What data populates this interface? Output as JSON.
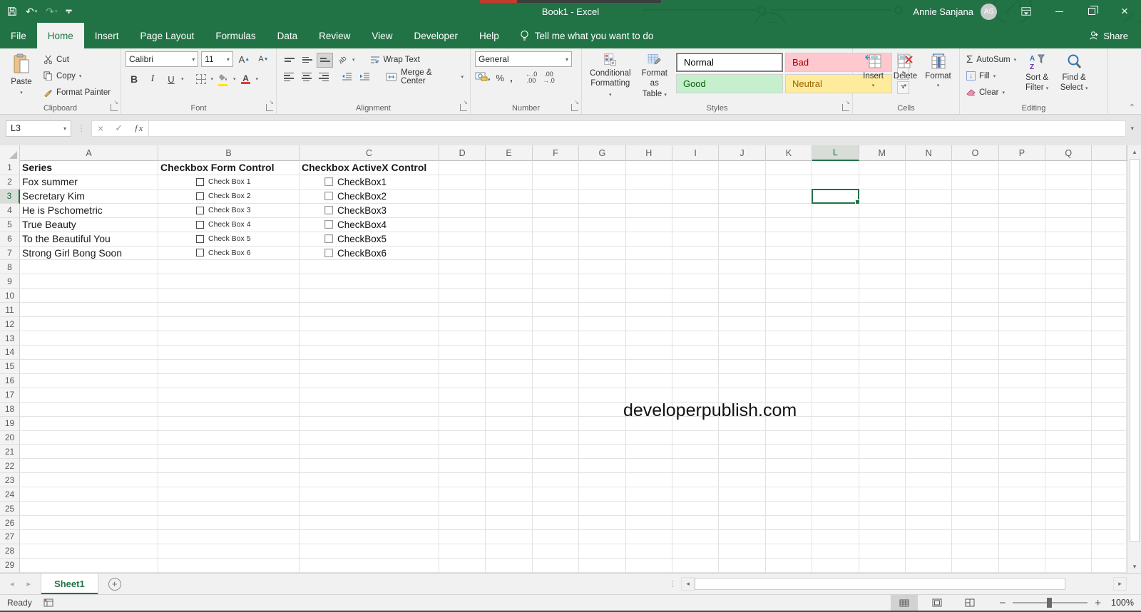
{
  "window": {
    "title": "Book1  -  Excel",
    "user_name": "Annie Sanjana",
    "avatar_initials": "AS",
    "share_label": "Share"
  },
  "menu": {
    "tabs": [
      {
        "label": "File"
      },
      {
        "label": "Home"
      },
      {
        "label": "Insert"
      },
      {
        "label": "Page Layout"
      },
      {
        "label": "Formulas"
      },
      {
        "label": "Data"
      },
      {
        "label": "Review"
      },
      {
        "label": "View"
      },
      {
        "label": "Developer"
      },
      {
        "label": "Help"
      }
    ],
    "active_tab": "Home",
    "tell_me": "Tell me what you want to do"
  },
  "ribbon": {
    "clipboard": {
      "title": "Clipboard",
      "paste": "Paste",
      "cut": "Cut",
      "copy": "Copy",
      "format_painter": "Format Painter"
    },
    "font": {
      "title": "Font",
      "family": "Calibri",
      "size": "11",
      "bold": "B",
      "italic": "I",
      "underline": "U"
    },
    "alignment": {
      "title": "Alignment",
      "wrap_text": "Wrap Text",
      "merge_center": "Merge & Center"
    },
    "number": {
      "title": "Number",
      "format": "General",
      "percent": "%",
      "comma": ","
    },
    "styles": {
      "title": "Styles",
      "conditional": "Conditional Formatting",
      "format_table": "Format as Table",
      "gallery": [
        {
          "label": "Normal",
          "bg": "#ffffff",
          "fg": "#222222"
        },
        {
          "label": "Bad",
          "bg": "#FFC7CE",
          "fg": "#9C0006"
        },
        {
          "label": "Good",
          "bg": "#C6EFCE",
          "fg": "#006100"
        },
        {
          "label": "Neutral",
          "bg": "#FFEB9C",
          "fg": "#9C6500"
        }
      ]
    },
    "cells": {
      "title": "Cells",
      "insert": "Insert",
      "delete": "Delete",
      "format": "Format"
    },
    "editing": {
      "title": "Editing",
      "autosum": "AutoSum",
      "fill": "Fill",
      "clear": "Clear",
      "sort_filter": "Sort & Filter",
      "find_select": "Find & Select"
    }
  },
  "formula_bar": {
    "name_box_value": "L3",
    "formula_value": ""
  },
  "sheet": {
    "column_letters": [
      "A",
      "B",
      "C",
      "D",
      "E",
      "F",
      "G",
      "H",
      "I",
      "J",
      "K",
      "L",
      "M",
      "N",
      "O",
      "P",
      "Q"
    ],
    "row_count": 29,
    "selection": {
      "cell": "L3",
      "column": "L",
      "row": 3
    },
    "table": {
      "headers": {
        "a": "Series",
        "b": "Checkbox Form Control",
        "c": "Checkbox ActiveX Control"
      },
      "rows": [
        {
          "series": "Fox summer",
          "form_label": "Check Box 1",
          "activex_label": "CheckBox1"
        },
        {
          "series": "Secretary Kim",
          "form_label": "Check Box 2",
          "activex_label": "CheckBox2"
        },
        {
          "series": "He is Pschometric",
          "form_label": "Check Box 3",
          "activex_label": "CheckBox3"
        },
        {
          "series": "True Beauty",
          "form_label": "Check Box 4",
          "activex_label": "CheckBox4"
        },
        {
          "series": "To the Beautiful You",
          "form_label": "Check Box 5",
          "activex_label": "CheckBox5"
        },
        {
          "series": "Strong Girl Bong Soon",
          "form_label": "Check Box 6",
          "activex_label": "CheckBox6"
        }
      ]
    },
    "watermark": "developerpublish.com"
  },
  "sheet_tabs": {
    "tabs": [
      {
        "label": "Sheet1",
        "active": true
      }
    ]
  },
  "status_bar": {
    "status": "Ready",
    "zoom_level": "100%"
  },
  "colors": {
    "accent_green": "#217346"
  }
}
